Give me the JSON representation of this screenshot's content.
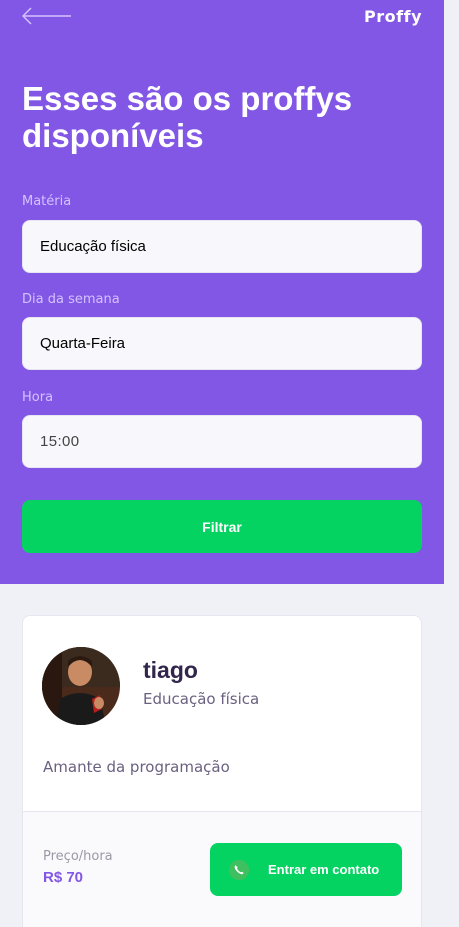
{
  "header": {
    "logo": "Proffy",
    "title": "Esses são os proffys disponíveis",
    "back_icon": "arrow-left-icon"
  },
  "filters": {
    "subject_label": "Matéria",
    "subject_value": "Educação física",
    "weekday_label": "Dia da semana",
    "weekday_value": "Quarta-Feira",
    "time_label": "Hora",
    "time_value": "15:00",
    "submit_label": "Filtrar"
  },
  "teacher": {
    "name": "tiago",
    "subject": "Educação física",
    "bio": "Amante da programação",
    "price_label": "Preço/hora",
    "price_value": "R$ 70",
    "contact_label": "Entrar em contato",
    "contact_icon": "whatsapp-icon"
  },
  "colors": {
    "primary": "#8257E5",
    "secondary": "#04D361",
    "background": "#F0F0F7",
    "text_title": "#32264D",
    "text_base": "#6A6180"
  }
}
